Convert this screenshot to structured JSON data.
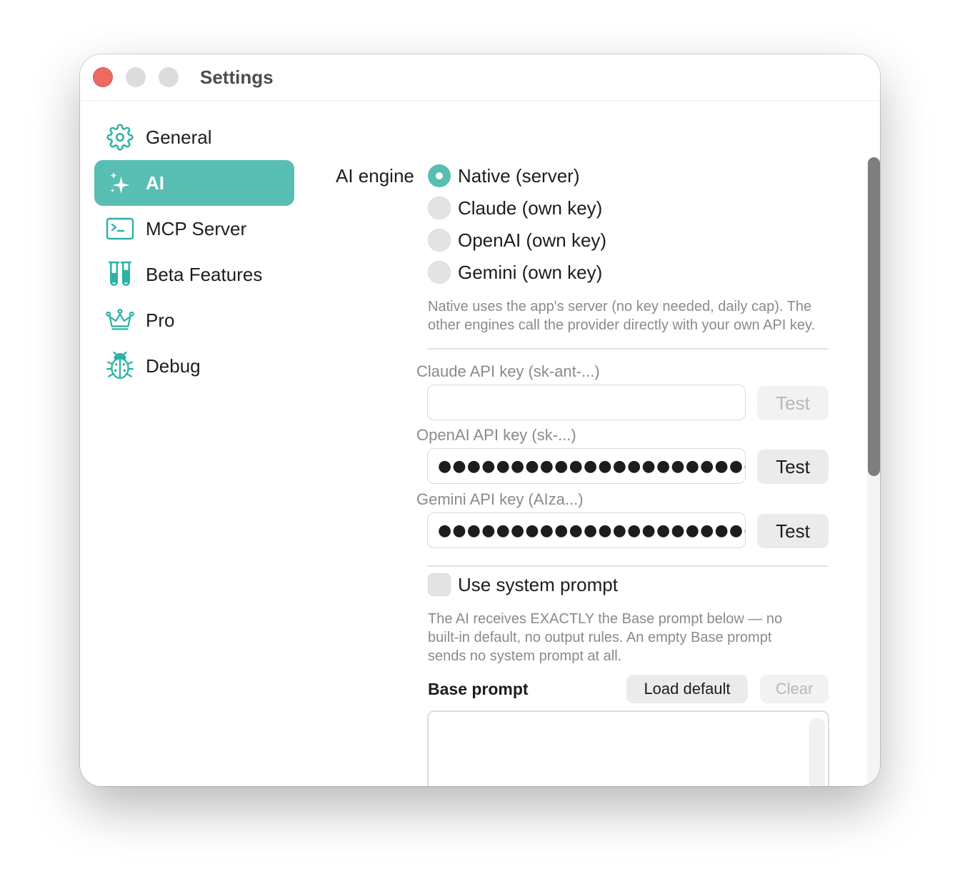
{
  "window": {
    "title": "Settings"
  },
  "sidebar": {
    "items": [
      {
        "label": "General",
        "icon": "gear-icon",
        "active": false
      },
      {
        "label": "AI",
        "icon": "sparkles-icon",
        "active": true
      },
      {
        "label": "MCP Server",
        "icon": "terminal-icon",
        "active": false
      },
      {
        "label": "Beta Features",
        "icon": "test-tubes-icon",
        "active": false
      },
      {
        "label": "Pro",
        "icon": "crown-icon",
        "active": false
      },
      {
        "label": "Debug",
        "icon": "ladybug-icon",
        "active": false
      }
    ]
  },
  "ai": {
    "engine_label": "AI engine",
    "engines": [
      {
        "label": "Native (server)",
        "selected": true
      },
      {
        "label": "Claude (own key)",
        "selected": false
      },
      {
        "label": "OpenAI (own key)",
        "selected": false
      },
      {
        "label": "Gemini (own key)",
        "selected": false
      }
    ],
    "engine_help": [
      "Native uses the app's server (no key needed, daily cap). The",
      "other engines call the provider directly with your own API key."
    ],
    "keys": [
      {
        "label": "Claude API key (sk-ant-...)",
        "value": "",
        "test_label": "Test",
        "test_enabled": false
      },
      {
        "label": "OpenAI API key (sk-...)",
        "value": "●●●●●●●●●●●●●●●●●●●●●●●●●●●●●●●●●●",
        "test_label": "Test",
        "test_enabled": true
      },
      {
        "label": "Gemini API key (AIza...)",
        "value": "●●●●●●●●●●●●●●●●●●●●●●●●●●●●●●●●●●",
        "test_label": "Test",
        "test_enabled": true
      }
    ],
    "system_prompt": {
      "checkbox_label": "Use system prompt",
      "checked": false,
      "help": [
        "The AI receives EXACTLY the Base prompt below — no",
        "built-in default, no output rules. An empty Base prompt",
        "sends no system prompt at all."
      ],
      "base_prompt_label": "Base prompt",
      "load_default_label": "Load default",
      "clear_label": "Clear",
      "value": ""
    }
  },
  "colors": {
    "accent": "#58bdb2",
    "icon": "#2bb3a8",
    "close": "#ec6a5f"
  }
}
